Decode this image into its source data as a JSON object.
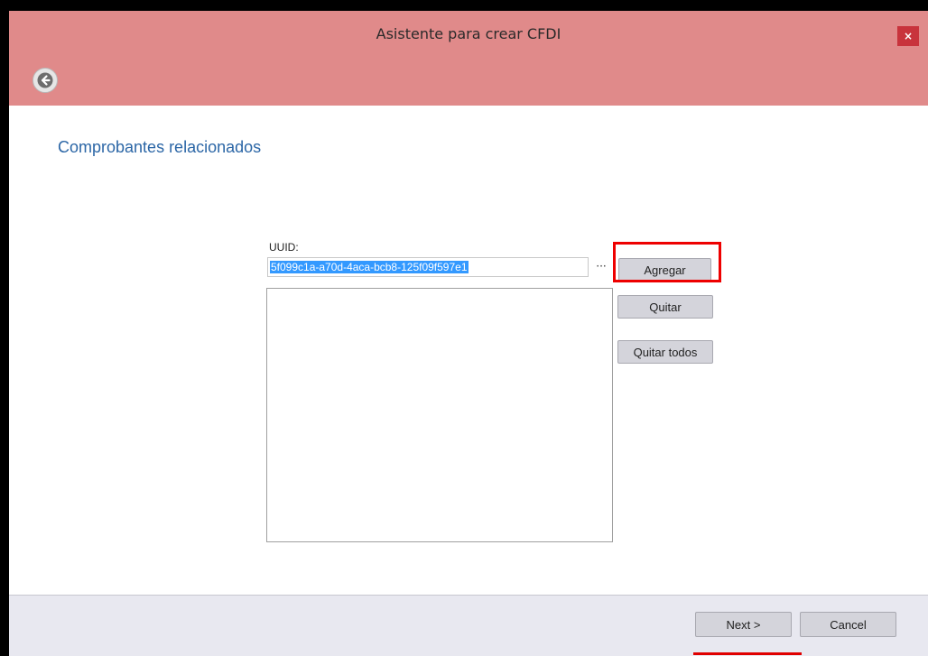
{
  "window": {
    "title": "Asistente para crear CFDI",
    "close_glyph": "×"
  },
  "header": {
    "back_icon": "back-arrow-icon"
  },
  "main": {
    "heading": "Comprobantes relacionados",
    "uuid_label": "UUID:",
    "uuid_value": "5f099c1a-a70d-4aca-bcb8-125f09f597e1",
    "browse_label": "···",
    "add_label": "Agregar",
    "remove_label": "Quitar",
    "remove_all_label": "Quitar todos",
    "uuid_list_items": []
  },
  "footer": {
    "next_label": "Next >",
    "cancel_label": "Cancel"
  },
  "colors": {
    "title_bar_bg": "#e08a8a",
    "accent_heading": "#2b66a6",
    "highlight": "#ee0000",
    "close_button_bg": "#c8333c",
    "selection_bg": "#3399ff"
  }
}
